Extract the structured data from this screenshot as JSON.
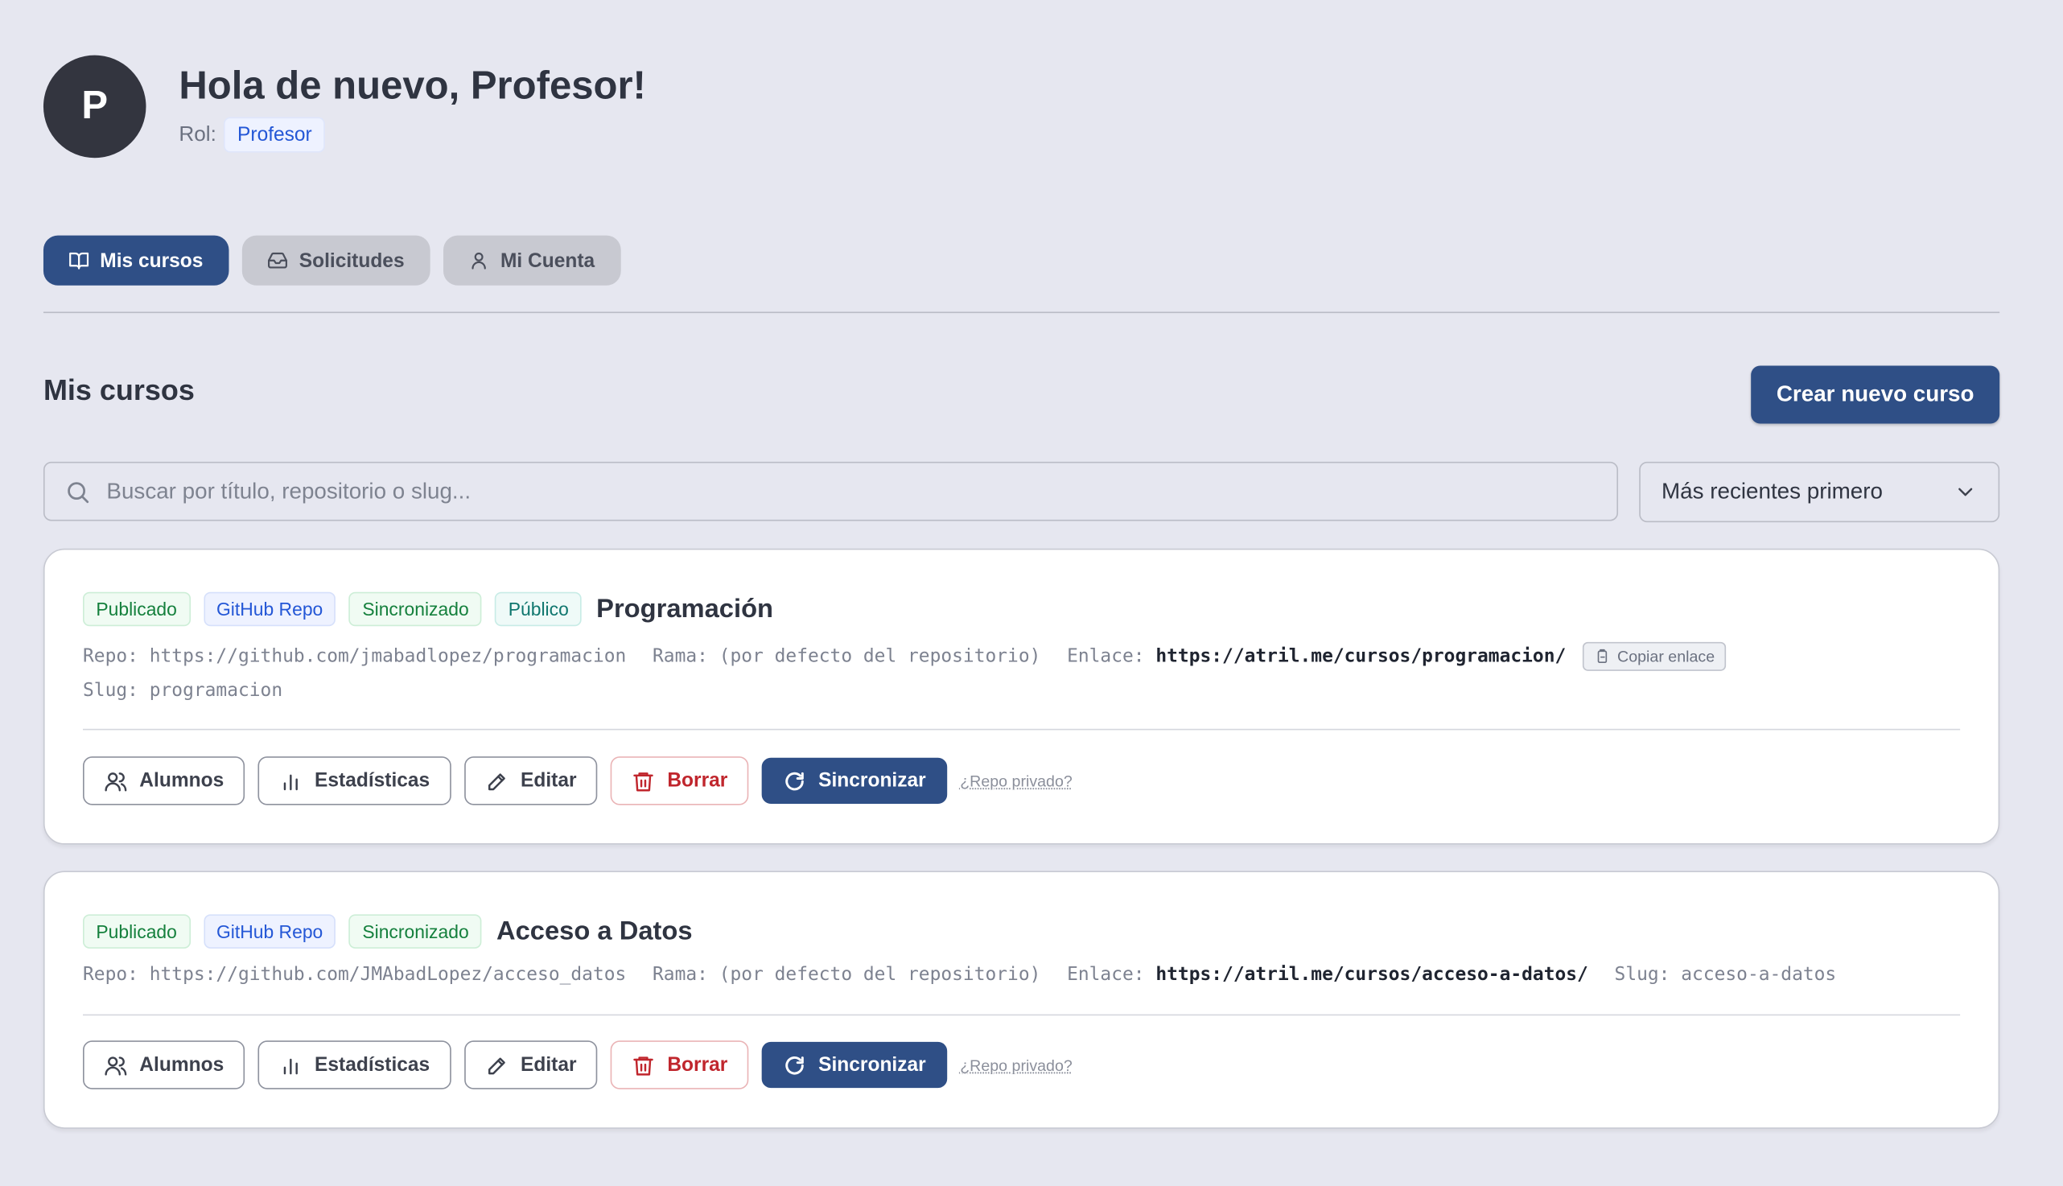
{
  "header": {
    "avatar_initial": "P",
    "greeting": "Hola de nuevo, Profesor!",
    "role_label": "Rol:",
    "role_value": "Profesor"
  },
  "tabs": [
    {
      "label": "Mis cursos",
      "icon": "book-open-icon",
      "active": true
    },
    {
      "label": "Solicitudes",
      "icon": "inbox-icon",
      "active": false
    },
    {
      "label": "Mi Cuenta",
      "icon": "user-icon",
      "active": false
    }
  ],
  "section": {
    "title": "Mis cursos",
    "create_button": "Crear nuevo curso"
  },
  "search": {
    "placeholder": "Buscar por título, repositorio o slug..."
  },
  "sort": {
    "selected": "Más recientes primero"
  },
  "courses": [
    {
      "badges": [
        "Publicado",
        "GitHub Repo",
        "Sincronizado",
        "Público"
      ],
      "title": "Programación",
      "repo_label": "Repo:",
      "repo": "https://github.com/jmabadlopez/programacion",
      "branch_label": "Rama:",
      "branch": "(por defecto del repositorio)",
      "link_label": "Enlace:",
      "link": "https://atril.me/cursos/programacion/",
      "copy_label": "Copiar enlace",
      "slug_label": "Slug:",
      "slug": "programacion"
    },
    {
      "badges": [
        "Publicado",
        "GitHub Repo",
        "Sincronizado"
      ],
      "title": "Acceso a Datos",
      "repo_label": "Repo:",
      "repo": "https://github.com/JMAbadLopez/acceso_datos",
      "branch_label": "Rama:",
      "branch": "(por defecto del repositorio)",
      "link_label": "Enlace:",
      "link": "https://atril.me/cursos/acceso-a-datos/",
      "slug_label": "Slug:",
      "slug": "acceso-a-datos"
    }
  ],
  "actions": {
    "students": "Alumnos",
    "stats": "Estadísticas",
    "edit": "Editar",
    "delete": "Borrar",
    "sync": "Sincronizar",
    "private_repo": "¿Repo privado?"
  },
  "colors": {
    "background": "#e6e7f0",
    "primary": "#2f4f86",
    "danger": "#c0262d",
    "success": "#15803d",
    "info": "#2457d6"
  }
}
